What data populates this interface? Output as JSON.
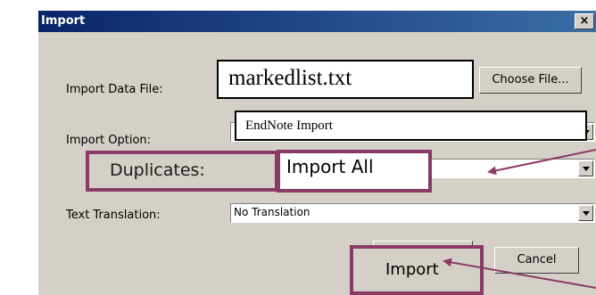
{
  "dialog": {
    "title": "Import",
    "close_glyph": "×"
  },
  "fields": {
    "data_file_label": "Import Data File:",
    "data_file_value": "markedlist.txt",
    "choose_file_label": "Choose File...",
    "option_label": "Import Option:",
    "option_value": "EndNote Import",
    "duplicates_label": "Duplicates:",
    "duplicates_value": "Import All",
    "translation_label": "Text Translation:",
    "translation_value": "No Translation"
  },
  "buttons": {
    "import": "Import",
    "cancel": "Cancel"
  },
  "annotation": {
    "highlight_color": "#8a3a66",
    "arrow_icon": "arrow-icon"
  }
}
